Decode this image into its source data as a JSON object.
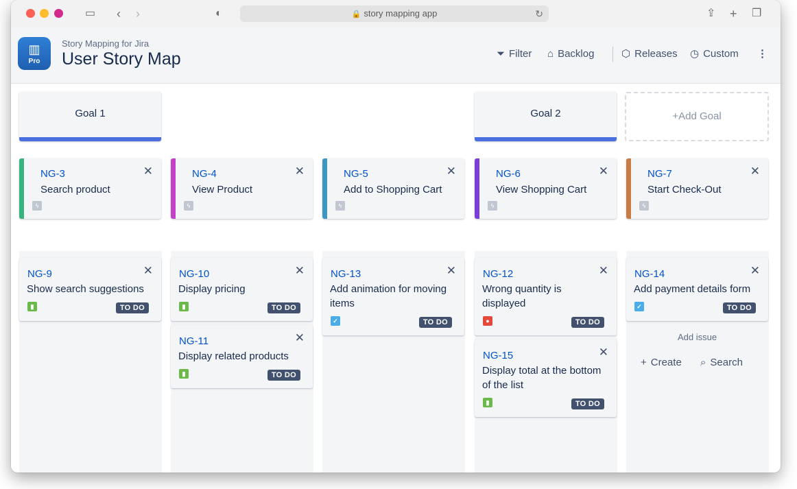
{
  "browser": {
    "url": "story mapping app"
  },
  "header": {
    "logo_text": "Pro",
    "subtitle": "Story Mapping for Jira",
    "title": "User Story Map",
    "buttons": {
      "filter": "Filter",
      "backlog": "Backlog",
      "releases": "Releases",
      "custom": "Custom"
    }
  },
  "goals": {
    "goal1": "Goal 1",
    "goal2": "Goal 2",
    "add_goal": "Add Goal",
    "color": "#4c6fe0"
  },
  "epics": [
    {
      "key": "NG-3",
      "summary": "Search product",
      "color": "#36b37e"
    },
    {
      "key": "NG-4",
      "summary": "View Product",
      "color": "#c341c6"
    },
    {
      "key": "NG-5",
      "summary": "Add to Shopping Cart",
      "color": "#3f97c1"
    },
    {
      "key": "NG-6",
      "summary": "View Shopping Cart",
      "color": "#7b3fd8"
    },
    {
      "key": "NG-7",
      "summary": "Start Check-Out",
      "color": "#c97b45"
    }
  ],
  "stories": [
    {
      "key": "NG-9",
      "summary": "Show search suggestions",
      "status": "TO DO",
      "type": "story-icon"
    },
    {
      "key": "NG-10",
      "summary": "Display pricing",
      "status": "TO DO",
      "type": "story-icon"
    },
    {
      "key": "NG-11",
      "summary": "Display related products",
      "status": "TO DO",
      "type": "story-icon"
    },
    {
      "key": "NG-13",
      "summary_line1": "Add animation for moving",
      "summary_line2": "items",
      "status": "TO DO",
      "type": "task-icon"
    },
    {
      "key": "NG-12",
      "summary_line1": "Wrong quantity is",
      "summary_line2": "displayed",
      "status": "TO DO",
      "type": "bug-icon"
    },
    {
      "key": "NG-15",
      "summary_line1": "Display total at the bottom",
      "summary_line2": "of the list",
      "status": "TO DO",
      "type": "story-icon"
    },
    {
      "key": "NG-14",
      "summary": "Add payment details form",
      "status": "TO DO",
      "type": "task-icon"
    }
  ],
  "add_issue": {
    "label": "Add issue",
    "create": "Create",
    "search": "Search"
  },
  "colors": {
    "story": "#6bb94b",
    "task": "#4bade8",
    "bug": "#e5493a",
    "badge": "#42526e",
    "link": "#0052cc"
  }
}
